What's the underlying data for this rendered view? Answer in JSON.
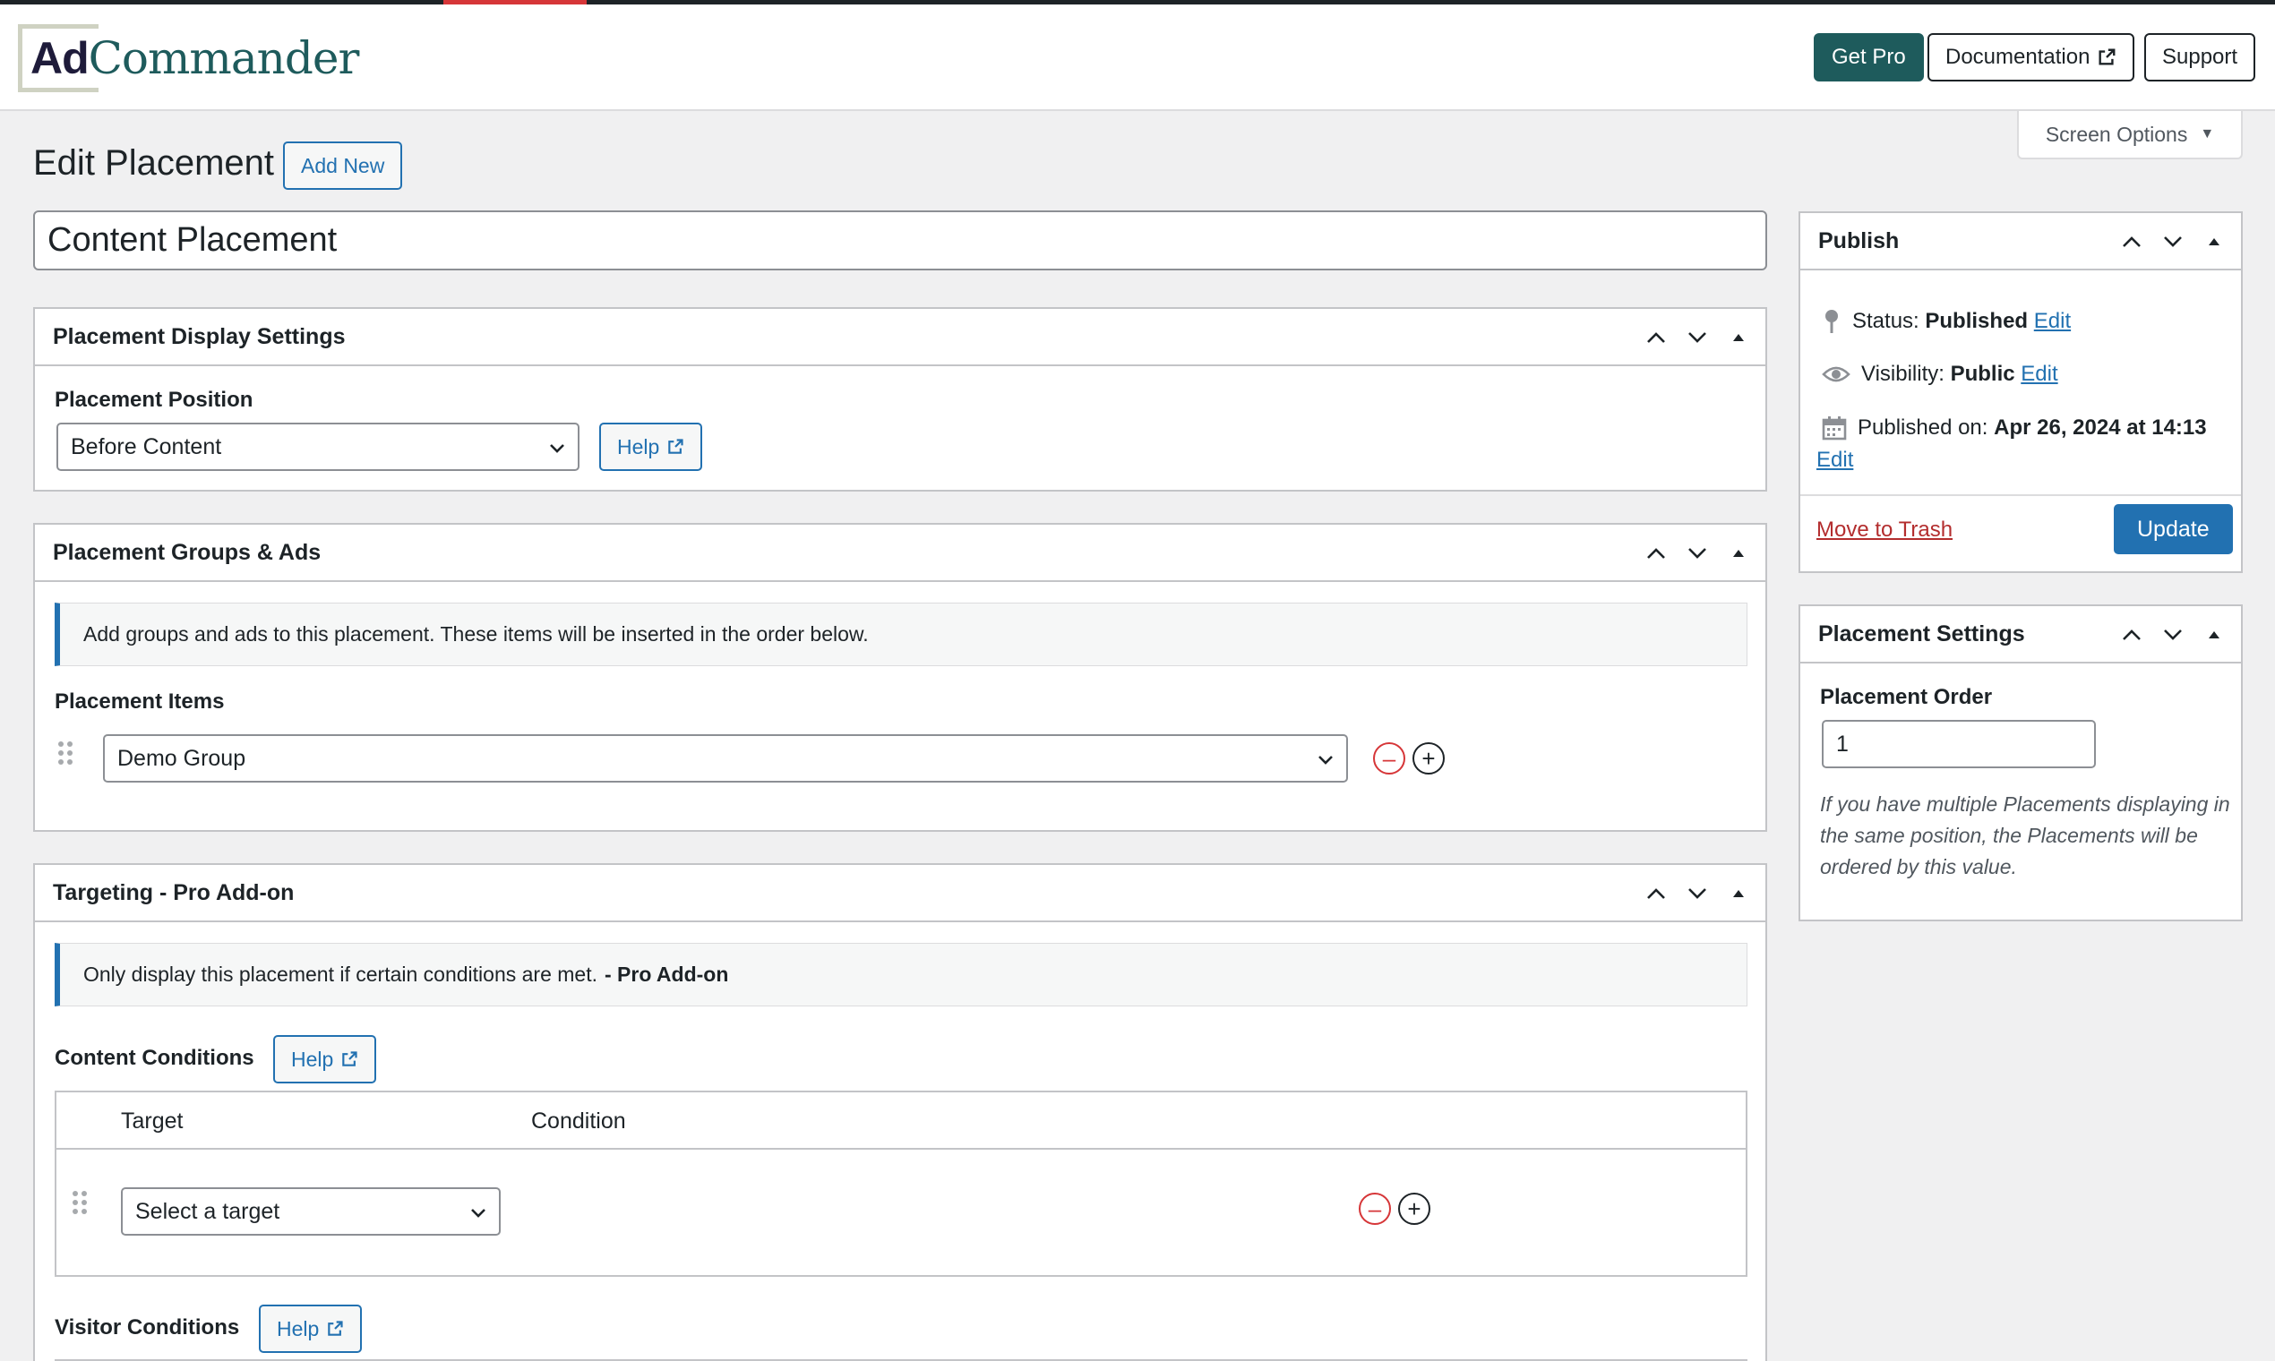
{
  "header": {
    "logo_ad": "Ad",
    "logo_commander": "Commander",
    "get_pro": "Get Pro",
    "documentation": "Documentation",
    "support": "Support"
  },
  "screen_options": "Screen Options",
  "page": {
    "title": "Edit Placement",
    "add_new": "Add New",
    "placement_title": "Content Placement"
  },
  "display_settings": {
    "heading": "Placement Display Settings",
    "position_label": "Placement Position",
    "position_value": "Before Content",
    "help": "Help"
  },
  "groups_ads": {
    "heading": "Placement Groups & Ads",
    "notice": "Add groups and ads to this placement. These items will be inserted in the order below.",
    "items_label": "Placement Items",
    "item_value": "Demo Group"
  },
  "targeting": {
    "heading": "Targeting - Pro Add-on",
    "notice": "Only display this placement if certain conditions are met.",
    "notice_bold": "- Pro Add-on",
    "content_conditions": "Content Conditions",
    "help": "Help",
    "col_target": "Target",
    "col_condition": "Condition",
    "target_placeholder": "Select a target",
    "visitor_conditions": "Visitor Conditions"
  },
  "publish": {
    "heading": "Publish",
    "status_label": "Status:",
    "status_value": "Published",
    "visibility_label": "Visibility:",
    "visibility_value": "Public",
    "published_label": "Published on:",
    "published_value": "Apr 26, 2024 at 14:13",
    "edit": "Edit",
    "trash": "Move to Trash",
    "update": "Update"
  },
  "placement_settings": {
    "heading": "Placement Settings",
    "order_label": "Placement Order",
    "order_value": "1",
    "description": "If you have multiple Placements displaying in the same position, the Placements will be ordered by this value."
  },
  "colors": {
    "accent": "#2271b1",
    "brand": "#1e5b5c",
    "danger": "#d63638"
  }
}
